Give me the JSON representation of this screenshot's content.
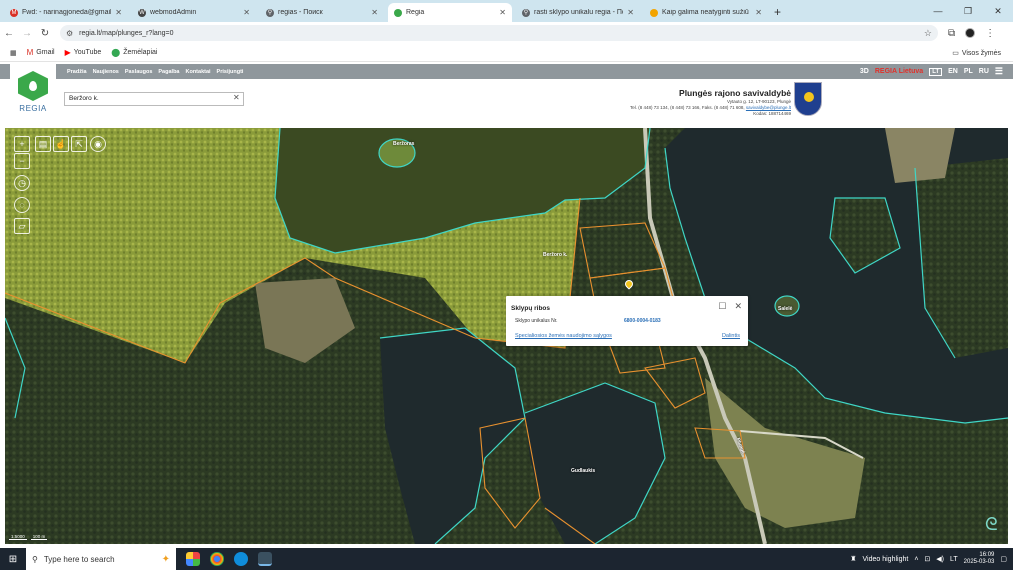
{
  "browser": {
    "tabs": [
      {
        "label": "Fwd: - narinagjoneda@gmail.c",
        "icon": "gmail-icon",
        "color": "#d93025",
        "glyph": "M"
      },
      {
        "label": "webmodAdmin",
        "icon": "w-icon",
        "color": "#444444",
        "glyph": "W"
      },
      {
        "label": "regias - Поиск",
        "icon": "search-icon",
        "color": "#5f6368",
        "glyph": "⚲"
      },
      {
        "label": "Regia",
        "icon": "regia-icon",
        "color": "#3aa84a",
        "glyph": "●",
        "active": true
      },
      {
        "label": "rasti sklypo unikalu regia - Пои",
        "icon": "search-icon",
        "color": "#5f6368",
        "glyph": "⚲"
      },
      {
        "label": "Kaip galima neatyginti sužiū",
        "icon": "page-icon",
        "color": "#f2a400",
        "glyph": "●"
      }
    ],
    "new_tab": "+",
    "url": "regia.lt/map/plunges_r?lang=0",
    "bookmarks": [
      {
        "label": "Gmail",
        "icon": "gmail-icon",
        "glyph": "M",
        "color": "#d93025"
      },
      {
        "label": "YouTube",
        "icon": "youtube-icon",
        "glyph": "▶",
        "color": "#ff0000"
      },
      {
        "label": "Žemėlapiai",
        "icon": "maps-pin-icon",
        "glyph": "⬤",
        "color": "#34a853"
      }
    ],
    "all_bookmarks": "Visos žymės"
  },
  "site": {
    "menu": [
      "Pradžia",
      "Naujienos",
      "Paslaugos",
      "Pagalba",
      "Kontaktai",
      "Prisijungti"
    ],
    "mode_3d": "3D",
    "brand_right": "REGIA Lietuva",
    "languages": [
      "LT",
      "EN",
      "PL",
      "RU"
    ],
    "logo_text": "REGIA",
    "search_value": "Beržoro k.",
    "municipality": {
      "name": "Plungės rajono savivaldybė",
      "address": "Vytauto g. 12, LT-90123, Plungė",
      "phones": "Tel. (8 448) 73 134, (8 448) 73 166, Faks. (8 448) 71 608,",
      "email": "savivaldybe@plunge.lt",
      "code": "Kodas: 188714469"
    }
  },
  "map": {
    "labels": [
      {
        "text": "Beržoras",
        "id": "label-island-north"
      },
      {
        "text": "Beržoro k.",
        "id": "label-village"
      },
      {
        "text": "Salelė",
        "id": "label-island-east"
      },
      {
        "text": "Gudlaukis",
        "id": "label-lake-south"
      },
      {
        "text": "Plungė",
        "id": "label-road"
      }
    ],
    "scale": [
      "1:5000",
      "100 m"
    ],
    "popup": {
      "title": "Sklypų ribos",
      "field_label": "Sklypo unikalus Nr.",
      "field_value": "6800-0004-0183",
      "link": "Specialiosios žemės naudojimo sąlygos",
      "share": "Dalintis"
    }
  },
  "taskbar": {
    "search_placeholder": "Type here to search",
    "video_highlight": "Video highlight",
    "lang": "LT",
    "time": "16:09",
    "date": "2025-03-03"
  },
  "colors": {
    "forest_light": "#8a9b3a",
    "forest_dark": "#2f3d26",
    "lake": "#1f2a2d",
    "lake_green": "#3b4a22",
    "boundary_cyan": "#3fd6c6",
    "boundary_orange": "#e8912f"
  }
}
